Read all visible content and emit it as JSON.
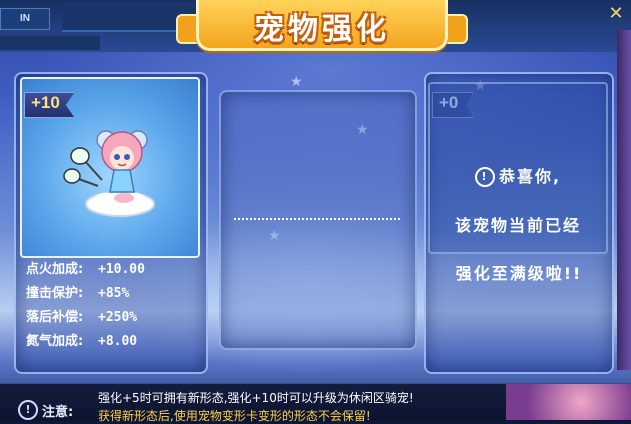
{
  "window": {
    "title": "宠物强化",
    "close_label": "✕",
    "top_left_tab": "IN"
  },
  "left_panel": {
    "level_badge": "+10",
    "stats": [
      {
        "name": "点火加成:",
        "value": "+10.00"
      },
      {
        "name": "撞击保护:",
        "value": "+85%"
      },
      {
        "name": "落后补偿:",
        "value": "+250%"
      },
      {
        "name": "氮气加成:",
        "value": "+8.00"
      }
    ]
  },
  "right_panel": {
    "level_badge": "+0",
    "message_line1": "恭喜你,",
    "message_line2": "该宠物当前已经",
    "message_line3": "强化至满级啦!!"
  },
  "note": {
    "label": "注意:",
    "line1": "强化+5时可拥有新形态,强化+10时可以升级为休闲区骑宠!",
    "line2": "获得新形态后,使用宠物变形卡变形的形态不会保留!"
  },
  "colors": {
    "title_orange": "#f3a51c",
    "badge_gold": "#ffe37a",
    "warning_yellow": "#ffcf4a"
  },
  "icons": {
    "info": "info-circle-icon",
    "close": "close-icon"
  }
}
